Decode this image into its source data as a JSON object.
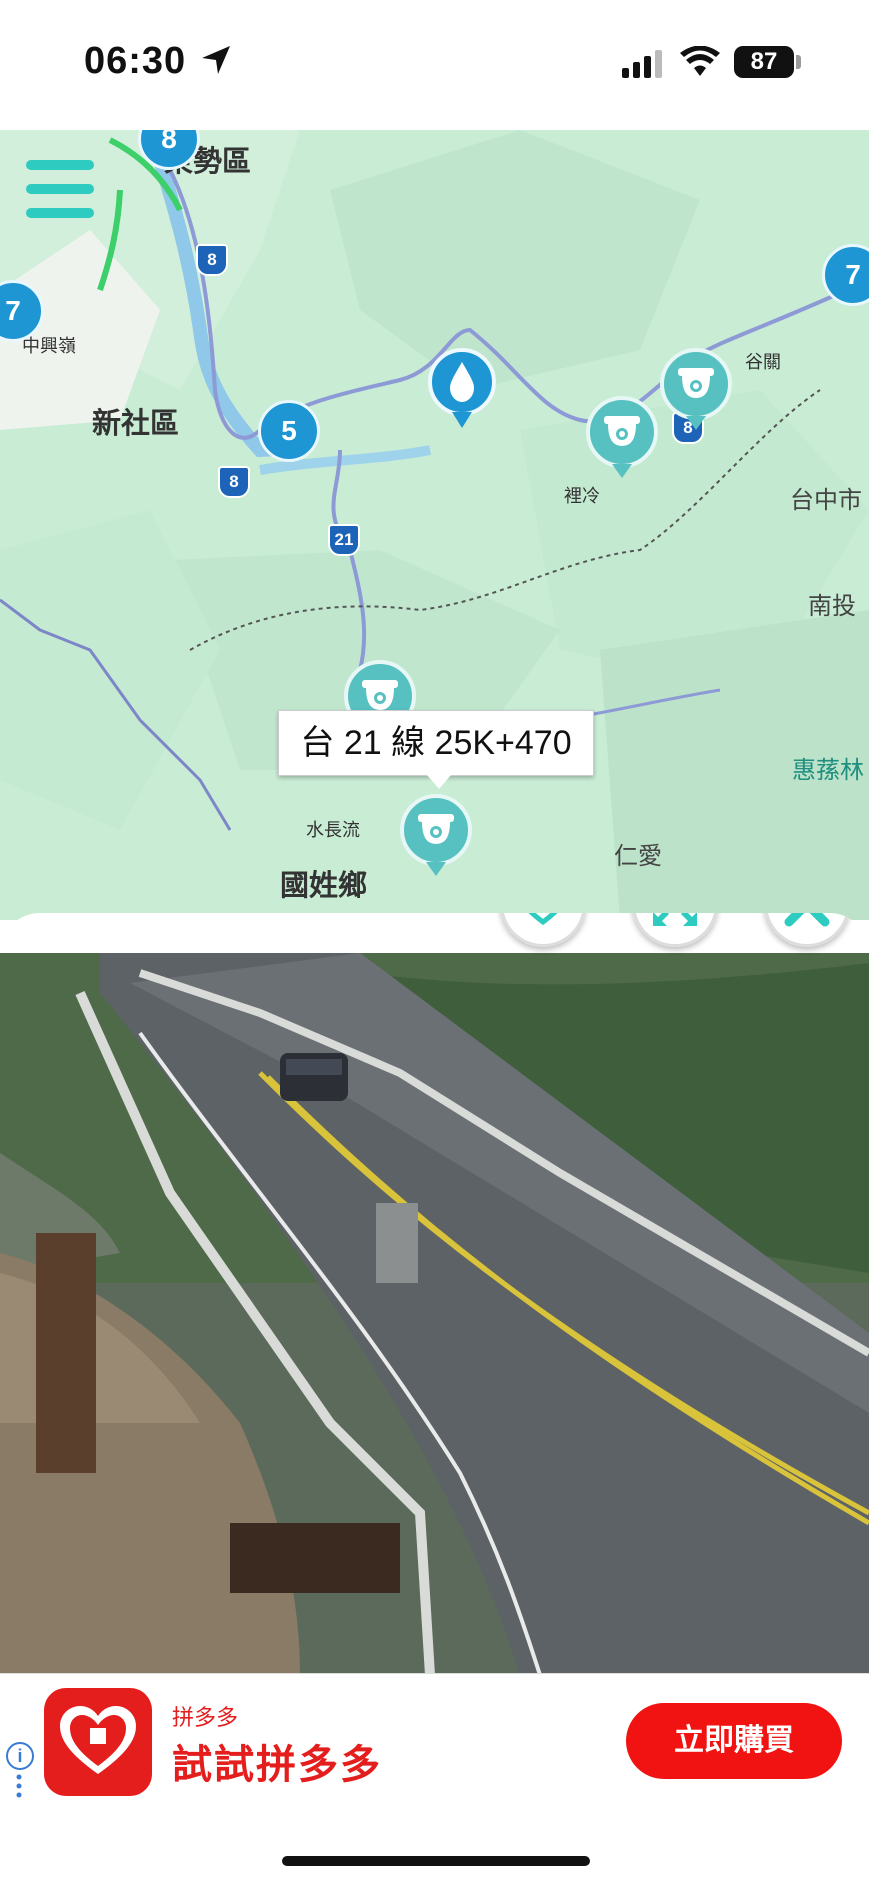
{
  "status_bar": {
    "time": "06:30",
    "battery": "87",
    "location_icon": "location-arrow-icon",
    "signal_icon": "cellular-signal-icon",
    "wifi_icon": "wifi-icon"
  },
  "map": {
    "labels": {
      "dongshi": "東勢區",
      "xinshe": "新社區",
      "zhongxingling": "中興嶺",
      "guguan": "谷關",
      "lileng": "裡冷",
      "taichung_city": "台中市",
      "nantou": "南投",
      "huisun": "惠蓀林",
      "shuichangliu": "水長流",
      "guoxing": "國姓鄉",
      "renai": "仁愛",
      "road_21_label": "台中市",
      "south_label": "南"
    },
    "clusters": {
      "c1": "8",
      "c2": "7",
      "c3": "5",
      "c4": "7"
    },
    "shields": {
      "s1": "8",
      "s2": "8",
      "s3": "21",
      "s4": "8"
    },
    "tooltip": "台 21 線 25K+470",
    "menu_icon": "menu-icon",
    "water_icon": "water-drop-icon",
    "camera_icon": "cctv-camera-icon"
  },
  "camera_panel": {
    "favorite_icon": "heart-icon",
    "fullscreen_icon": "expand-icon",
    "close_icon": "close-icon"
  },
  "ad": {
    "brand": "拼多多",
    "title": "試試拼多多",
    "cta": "立即購買",
    "info": "i"
  },
  "colors": {
    "accent": "#2ecbc1",
    "cluster": "#1d96d3",
    "ad_red": "#e41d1d"
  }
}
